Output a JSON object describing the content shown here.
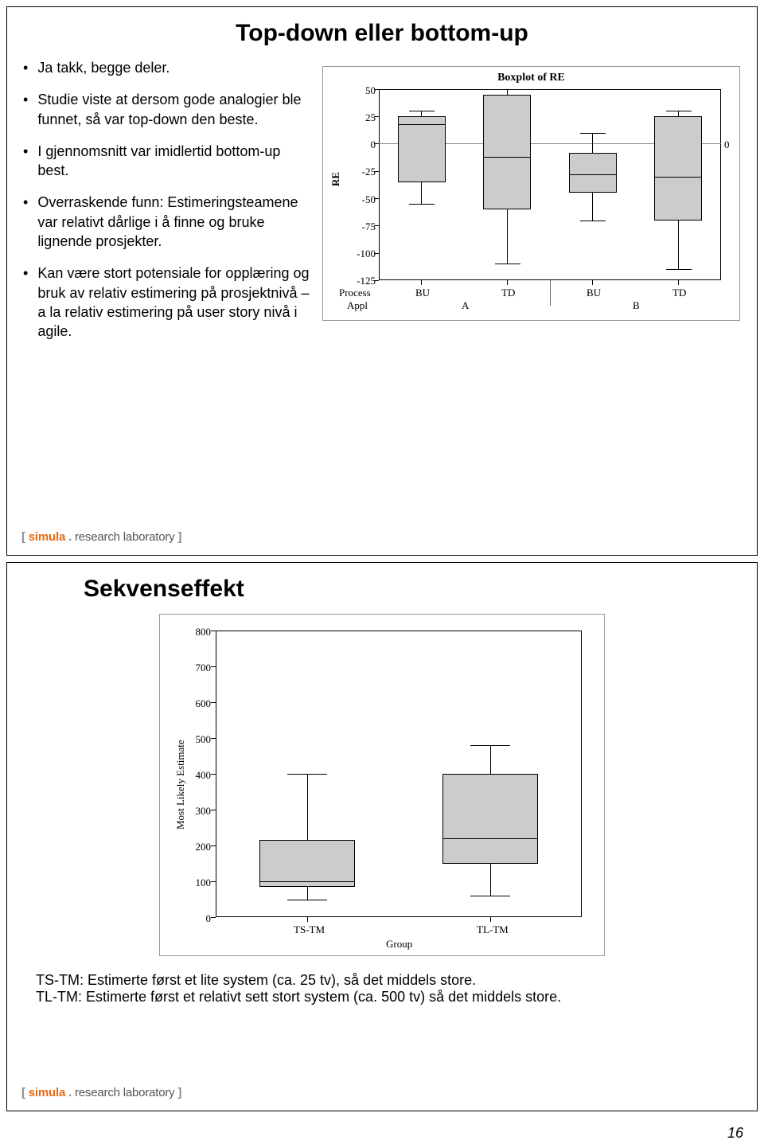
{
  "page_number": "16",
  "brand": {
    "bracket_open": "[ ",
    "simula": "simula ",
    "dot": ". ",
    "rest": "research laboratory ]",
    "full_open": "[",
    "full_close": "]"
  },
  "slide1": {
    "title": "Top-down eller bottom-up",
    "bullets": [
      "Ja takk, begge deler.",
      "Studie viste at dersom gode analogier ble funnet, så var top-down den beste.",
      "I gjennomsnitt var imidlertid bottom-up best.",
      "Overraskende funn: Estimeringsteamene var relativt dårlige i å finne og bruke lignende prosjekter.",
      "Kan være stort potensiale for opplæring og bruk av relativ estimering på prosjektnivå – a la relativ estimering på user story nivå i agile."
    ]
  },
  "slide2": {
    "title": "Sekvenseffekt",
    "caption1": "TS-TM: Estimerte først et lite system (ca. 25 tv), så det middels store.",
    "caption2": "TL-TM: Estimerte først et relativt sett stort system (ca. 500 tv) så det middels store."
  },
  "chart_data": [
    {
      "type": "boxplot",
      "slide": 1,
      "title": "Boxplot of RE",
      "ylabel": "RE",
      "ylim": [
        -125,
        50
      ],
      "yticks": [
        50,
        25,
        0,
        -25,
        -50,
        -75,
        -100,
        -125
      ],
      "ref_y": 0,
      "x_rows": [
        {
          "label": "Process",
          "values": [
            "BU",
            "TD",
            "BU",
            "TD"
          ]
        },
        {
          "label": "Appl",
          "values": [
            "A",
            "",
            "B",
            ""
          ]
        }
      ],
      "x_group_lines": [
        0.5,
        2.5,
        4.5
      ],
      "right_label": "0",
      "series": [
        {
          "name": "A-BU",
          "q1": -35,
          "median": 18,
          "q3": 25,
          "low": -55,
          "high": 30
        },
        {
          "name": "A-TD",
          "q1": -60,
          "median": -12,
          "q3": 45,
          "low": -110,
          "high": 55
        },
        {
          "name": "B-BU",
          "q1": -45,
          "median": -28,
          "q3": -8,
          "low": -70,
          "high": 10
        },
        {
          "name": "B-TD",
          "q1": -70,
          "median": -30,
          "q3": 25,
          "low": -115,
          "high": 30
        }
      ]
    },
    {
      "type": "boxplot",
      "slide": 2,
      "title": "",
      "xlabel": "Group",
      "ylabel": "Most Likely Estimate",
      "ylim": [
        0,
        800
      ],
      "yticks": [
        0,
        100,
        200,
        300,
        400,
        500,
        600,
        700,
        800
      ],
      "series": [
        {
          "name": "TS-TM",
          "q1": 85,
          "median": 100,
          "q3": 215,
          "low": 50,
          "high": 400
        },
        {
          "name": "TL-TM",
          "q1": 150,
          "median": 220,
          "q3": 400,
          "low": 60,
          "high": 480
        }
      ]
    }
  ]
}
